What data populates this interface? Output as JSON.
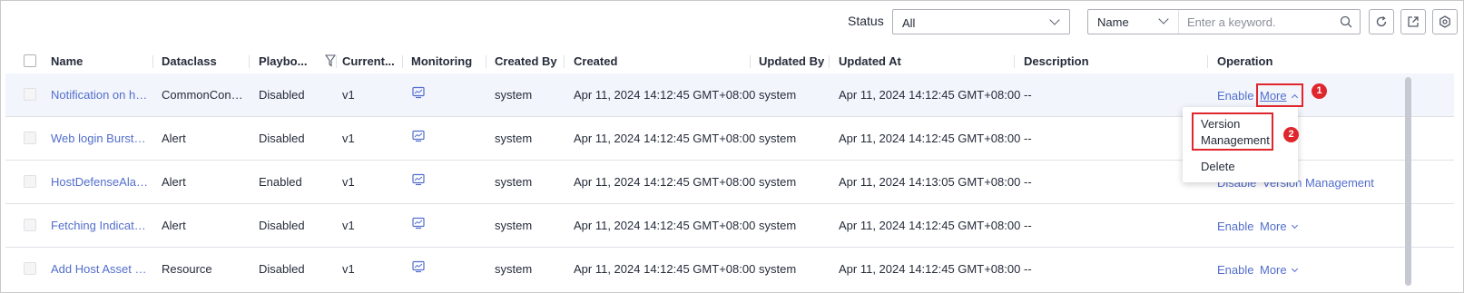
{
  "toolbar": {
    "status_label": "Status",
    "status_value": "All",
    "search_field": "Name",
    "search_placeholder": "Enter a keyword."
  },
  "columns": [
    "Name",
    "Dataclass",
    "Playbo...",
    "Current...",
    "Monitoring",
    "Created By",
    "Created",
    "Updated By",
    "Updated At",
    "Description",
    "Operation"
  ],
  "rows": [
    {
      "name": "Notification on ho...",
      "dataclass": "CommonCont...",
      "playbook": "Disabled",
      "current": "v1",
      "created_by": "system",
      "created": "Apr 11, 2024 14:12:45 GMT+08:00",
      "updated_by": "system",
      "updated_at": "Apr 11, 2024 14:12:45 GMT+08:00",
      "description": "--",
      "op1": "Enable",
      "op2": "More"
    },
    {
      "name": "Web login Burst I...",
      "dataclass": "Alert",
      "playbook": "Disabled",
      "current": "v1",
      "created_by": "system",
      "created": "Apr 11, 2024 14:12:45 GMT+08:00",
      "updated_by": "system",
      "updated_at": "Apr 11, 2024 14:12:45 GMT+08:00",
      "description": "--"
    },
    {
      "name": "HostDefenseAlar...",
      "dataclass": "Alert",
      "playbook": "Enabled",
      "current": "v1",
      "created_by": "system",
      "created": "Apr 11, 2024 14:12:45 GMT+08:00",
      "updated_by": "system",
      "updated_at": "Apr 11, 2024 14:13:05 GMT+08:00",
      "description": "--",
      "op1": "Disable",
      "op2": "Version Management"
    },
    {
      "name": "Fetching Indicato...",
      "dataclass": "Alert",
      "playbook": "Disabled",
      "current": "v1",
      "created_by": "system",
      "created": "Apr 11, 2024 14:12:45 GMT+08:00",
      "updated_by": "system",
      "updated_at": "Apr 11, 2024 14:12:45 GMT+08:00",
      "description": "--",
      "op1": "Enable",
      "op2": "More"
    },
    {
      "name": "Add Host Asset P...",
      "dataclass": "Resource",
      "playbook": "Disabled",
      "current": "v1",
      "created_by": "system",
      "created": "Apr 11, 2024 14:12:45 GMT+08:00",
      "updated_by": "system",
      "updated_at": "Apr 11, 2024 14:12:45 GMT+08:00",
      "description": "--",
      "op1": "Enable",
      "op2": "More"
    }
  ],
  "dropdown": {
    "version_management_line1": "Version",
    "version_management_line2": "Management",
    "delete": "Delete"
  },
  "annotations": {
    "badge1": "1",
    "badge2": "2"
  },
  "colors": {
    "link": "#526ecc",
    "highlight": "#e0262d"
  }
}
